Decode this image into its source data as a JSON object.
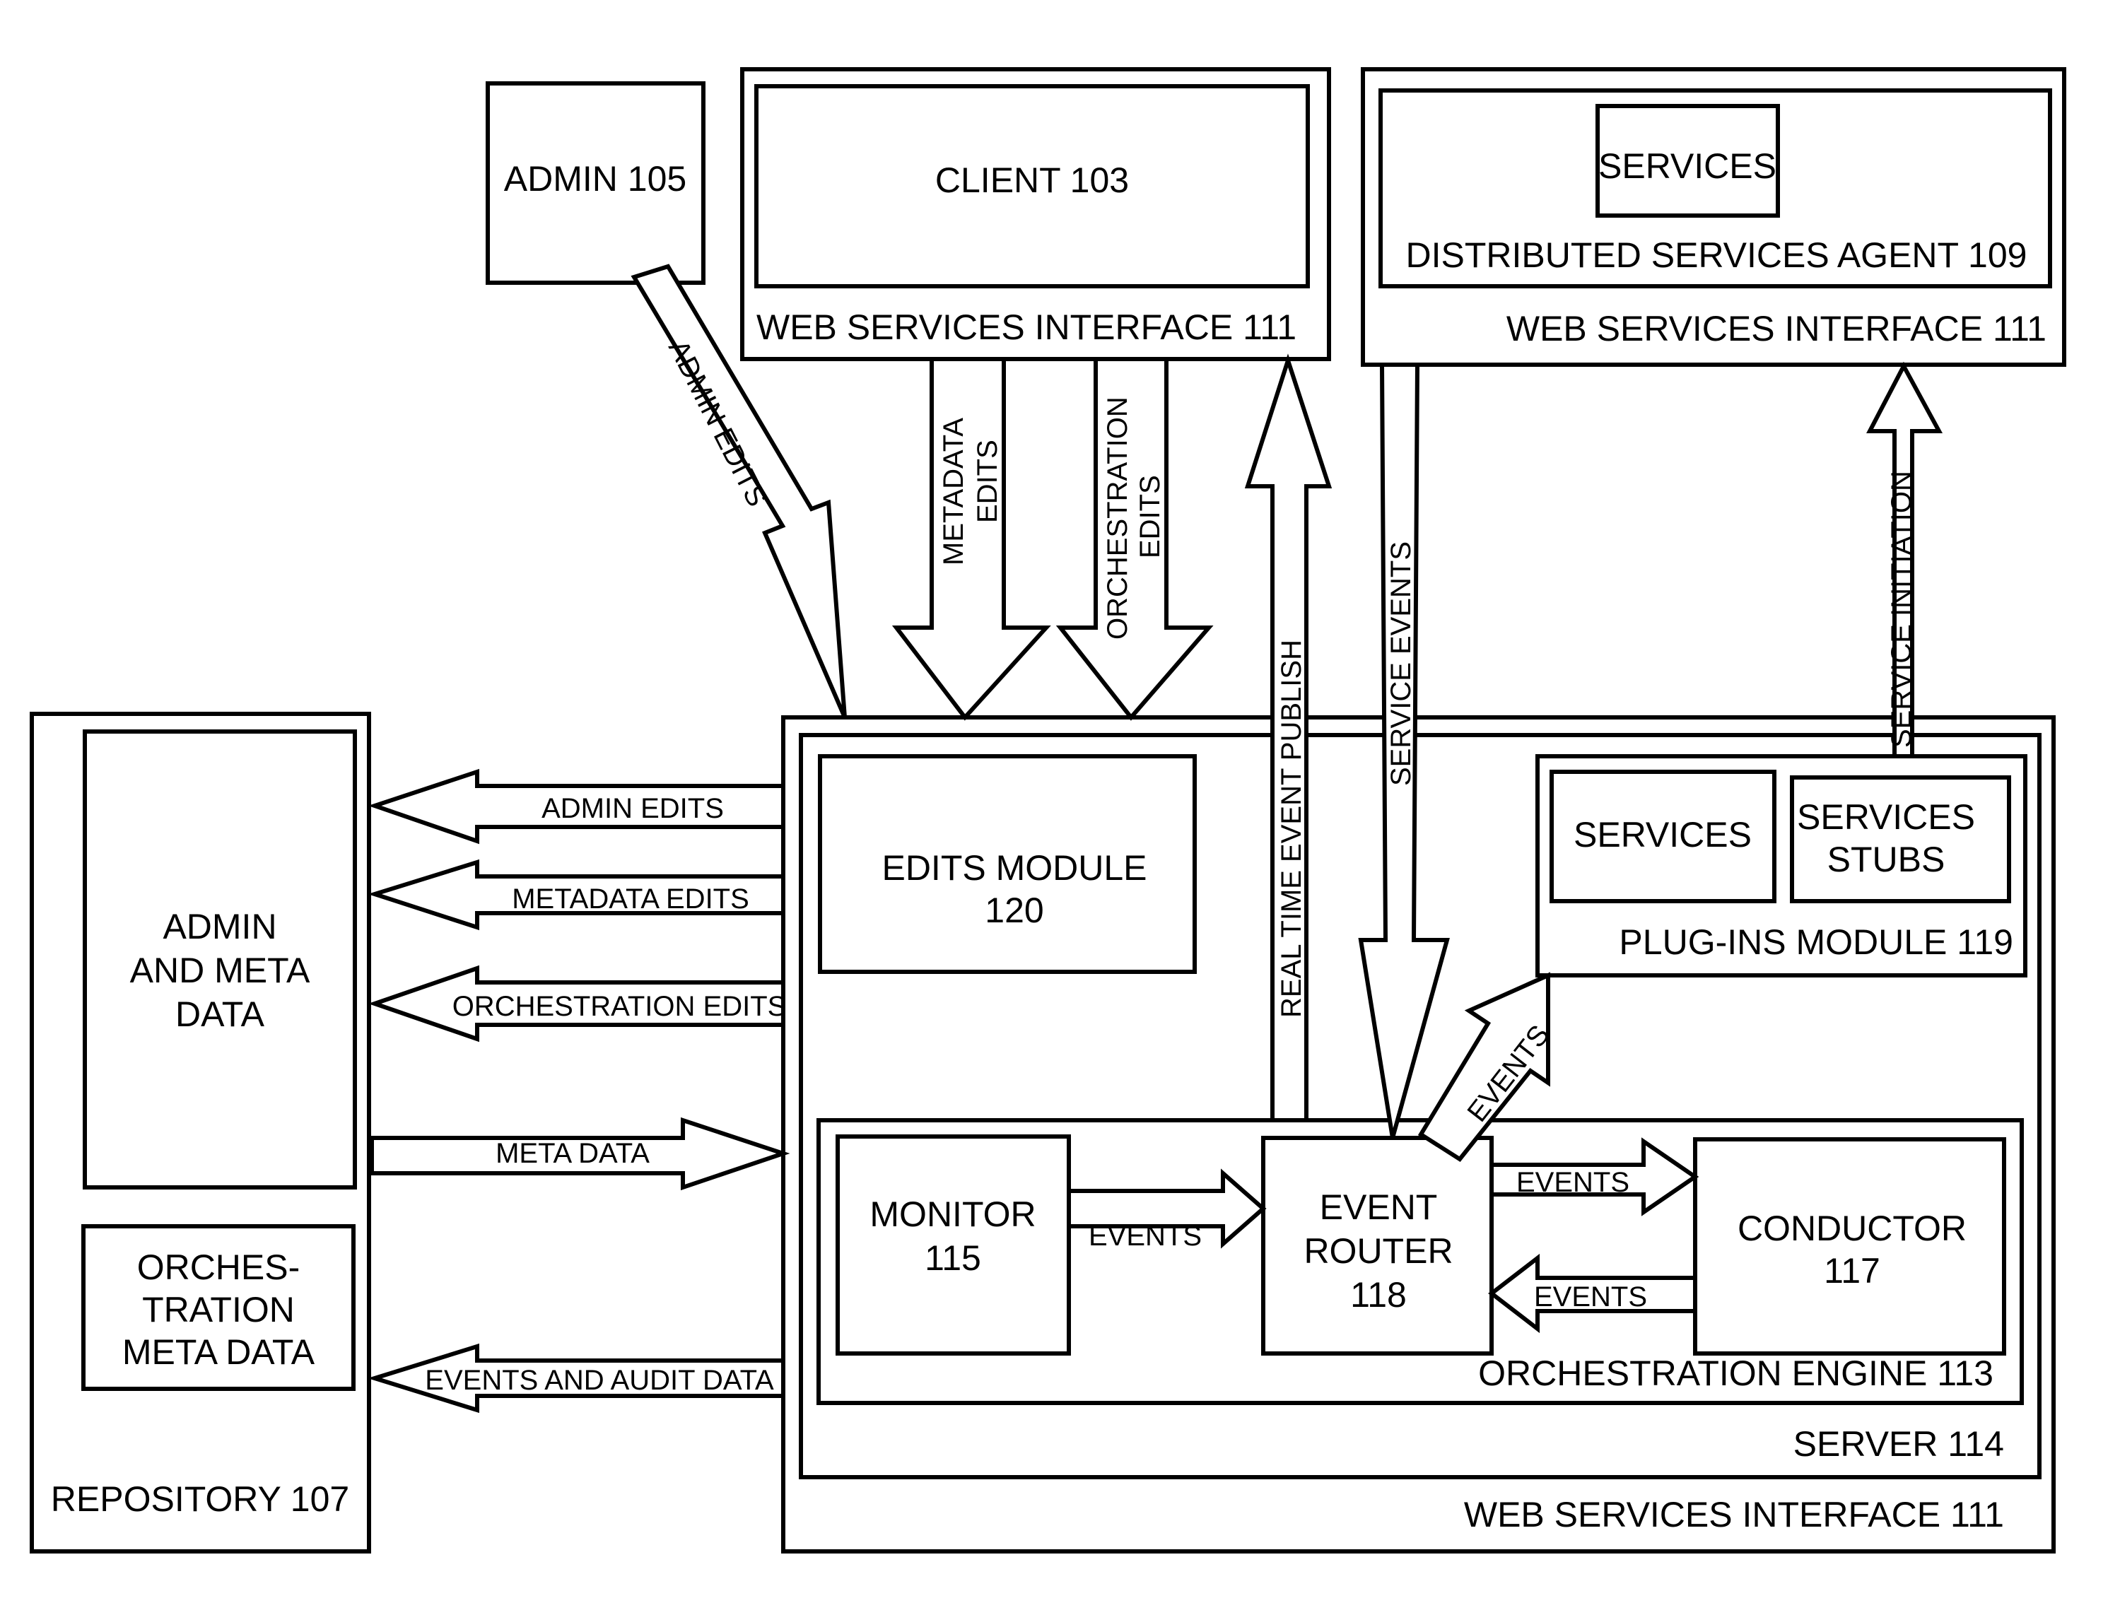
{
  "diagram": {
    "admin": {
      "label": "ADMIN 105"
    },
    "client_interface": {
      "client": {
        "label": "CLIENT 103"
      },
      "interface_label": "WEB SERVICES INTERFACE 111"
    },
    "distributed_interface": {
      "services": {
        "label": "SERVICES"
      },
      "agent_label": "DISTRIBUTED SERVICES AGENT 109",
      "interface_label": "WEB SERVICES INTERFACE 111"
    },
    "repository": {
      "label": "REPOSITORY 107",
      "admin_meta": {
        "lines": [
          "ADMIN",
          "AND META",
          "DATA"
        ]
      },
      "orch_meta": {
        "lines": [
          "ORCHES-",
          "TRATION",
          "META DATA"
        ]
      }
    },
    "server_interface": {
      "interface_label": "WEB SERVICES INTERFACE 111",
      "server_label": "SERVER 114",
      "edits_module": {
        "lines": [
          "EDITS MODULE",
          "120"
        ]
      },
      "plugins_module": {
        "label": "PLUG-INS MODULE 119",
        "services": {
          "label": "SERVICES"
        },
        "stubs": {
          "lines": [
            "SERVICES",
            "STUBS"
          ]
        }
      },
      "orchestration_engine": {
        "label": "ORCHESTRATION ENGINE 113",
        "monitor": {
          "lines": [
            "MONITOR",
            "115"
          ]
        },
        "router": {
          "lines": [
            "EVENT",
            "ROUTER",
            "118"
          ]
        },
        "conductor": {
          "lines": [
            "CONDUCTOR",
            "117"
          ]
        }
      }
    },
    "arrows": {
      "admin_edits_diag": "ADMIN EDITS",
      "metadata_edits_down": [
        "METADATA",
        "EDITS"
      ],
      "orchestration_edits_down": [
        "ORCHESTRATION",
        "EDITS"
      ],
      "real_time_publish": "REAL TIME EVENT PUBLISH",
      "service_events": "SERVICE EVENTS",
      "service_initiation": "SERVICE INITIATION",
      "repo_admin_edits": "ADMIN EDITS",
      "repo_metadata_edits": "METADATA EDITS",
      "repo_orchestration_edits": "ORCHESTRATION EDITS",
      "repo_meta_data": "META DATA",
      "repo_events_audit": "EVENTS AND AUDIT DATA",
      "monitor_to_router": "EVENTS",
      "router_to_conductor": "EVENTS",
      "conductor_to_router": "EVENTS",
      "router_to_plugins": "EVENTS"
    }
  }
}
